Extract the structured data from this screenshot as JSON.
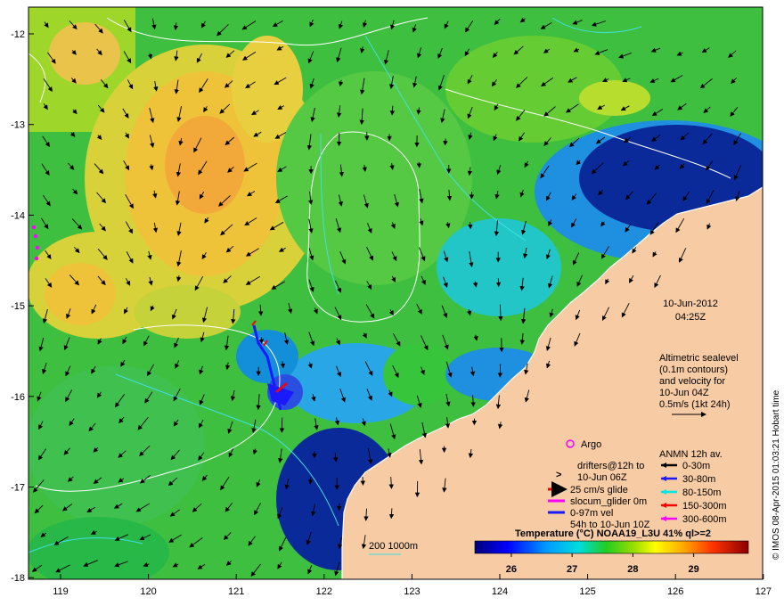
{
  "map": {
    "date": "10-Jun-2012",
    "time": "04:25Z",
    "altimetry": {
      "lines": [
        "Altimetric sealevel",
        "(0.1m contours)",
        "and velocity for",
        "10-Jun 04Z",
        "0.5m/s (1kt 24h)"
      ]
    },
    "argo_label": "Argo",
    "drifters": {
      "symbol": ">",
      "lines": [
        "drifters@12h to",
        "10-Jun 06Z"
      ]
    },
    "glider": {
      "glide_label": "25 cm/s glide",
      "slocum_label": "slocum_glider 0m",
      "vel_lines": [
        "0-97m vel",
        "54h to 10-Jun 10Z"
      ]
    },
    "anmn": {
      "title": "ANMN 12h av.",
      "items": [
        {
          "label": "0-30m",
          "color": "#000000"
        },
        {
          "label": "30-80m",
          "color": "#1a1aff"
        },
        {
          "label": "80-150m",
          "color": "#00e5e5"
        },
        {
          "label": "150-300m",
          "color": "#ff0000"
        },
        {
          "label": "300-600m",
          "color": "#ff00ff"
        }
      ]
    },
    "depth_contours_label": "200  1000m",
    "colorbar": {
      "title": "Temperature (°C) NOAA19_L3U 41% ql>=2",
      "ticks": [
        "26",
        "27",
        "28",
        "29"
      ],
      "tick_values": [
        26,
        27,
        28,
        29
      ],
      "min": 25.4,
      "max": 29.9
    },
    "y_ticks": [
      "-12",
      "-13",
      "-14",
      "-15",
      "-16",
      "-17",
      "-18"
    ],
    "x_ticks": [
      "119",
      "120",
      "121",
      "122",
      "123",
      "124",
      "125",
      "126",
      "127"
    ],
    "credit": "© IMOS 08-Apr-2015 01:03:21 Hobart time",
    "colors": {
      "land": "#f7cba4",
      "arrow_current": "#000000",
      "argo": "#ff00ff",
      "drifter": "#ff00ff",
      "glider_glide": "#ff0000",
      "glider_slocum": "#ff00ff",
      "glider_vel": "#1a1aff",
      "contour_sealevel": "#ffffff",
      "contour_depth": "#40e0e0"
    }
  }
}
